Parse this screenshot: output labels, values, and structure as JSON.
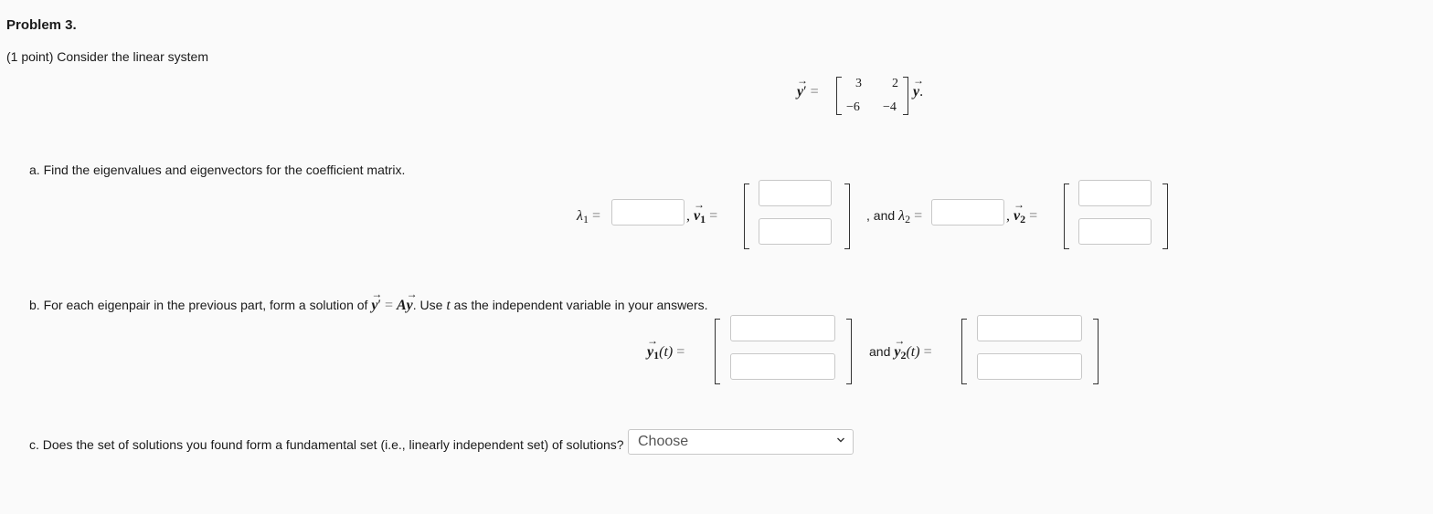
{
  "problem": {
    "title": "Problem 3.",
    "intro": "(1 point) Consider the linear system"
  },
  "system": {
    "lhs": "y",
    "matrix": [
      [
        "3",
        "2"
      ],
      [
        "−6",
        "−4"
      ]
    ],
    "rhs_tail": "."
  },
  "part_a": {
    "text": "a. Find the eigenvalues and eigenvectors for the coefficient matrix.",
    "lambda_sym": "λ",
    "v_sym": "v",
    "idx1": "1",
    "idx2": "2",
    "and_text": ", and",
    "comma": ","
  },
  "part_b": {
    "text_pre": "b. For each eigenpair in the previous part, form a solution of",
    "y_sym": "y",
    "A_sym": "A",
    "text_mid": ". Use",
    "t_sym": "t",
    "text_post": "as the independent variable in your answers.",
    "and_text": "and",
    "t_arg": "(t)"
  },
  "part_c": {
    "text": "c. Does the set of solutions you found form a fundamental set (i.e., linearly independent set) of solutions?",
    "select_value": "Choose"
  }
}
